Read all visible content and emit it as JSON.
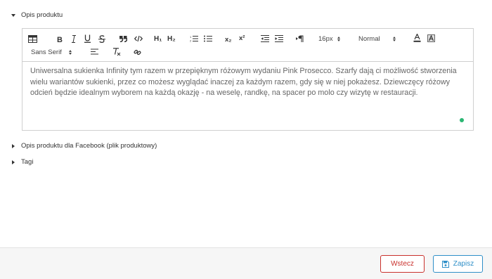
{
  "sections": {
    "description": {
      "label": "Opis produktu",
      "expanded": true
    },
    "facebook": {
      "label": "Opis produktu dla Facebook (plik produktowy)",
      "expanded": false
    },
    "tags": {
      "label": "Tagi",
      "expanded": false
    }
  },
  "toolbar": {
    "h1": "H₁",
    "h2": "H₂",
    "subscript": "x₂",
    "superscript": "x²",
    "font_size": "16px",
    "heading_style": "Normal",
    "font_family": "Sans Serif"
  },
  "editor": {
    "text": "Uniwersalna sukienka Infinity tym razem w przepięknym różowym wydaniu Pink Prosecco. Szarfy dają ci możliwość stworzenia wielu wariantów sukienki, przez co możesz wyglądać inaczej za każdym razem, gdy się w niej pokażesz. Dziewczęcy różowy odcień będzie idealnym wyborem na każdą okazję - na weselę, randkę, na spacer po molo czy wizytę w restauracji.",
    "status_color": "#2bb673"
  },
  "footer": {
    "back_label": "Wstecz",
    "save_label": "Zapisz"
  },
  "colors": {
    "back": "#c9302c",
    "save": "#2f8fc8"
  }
}
